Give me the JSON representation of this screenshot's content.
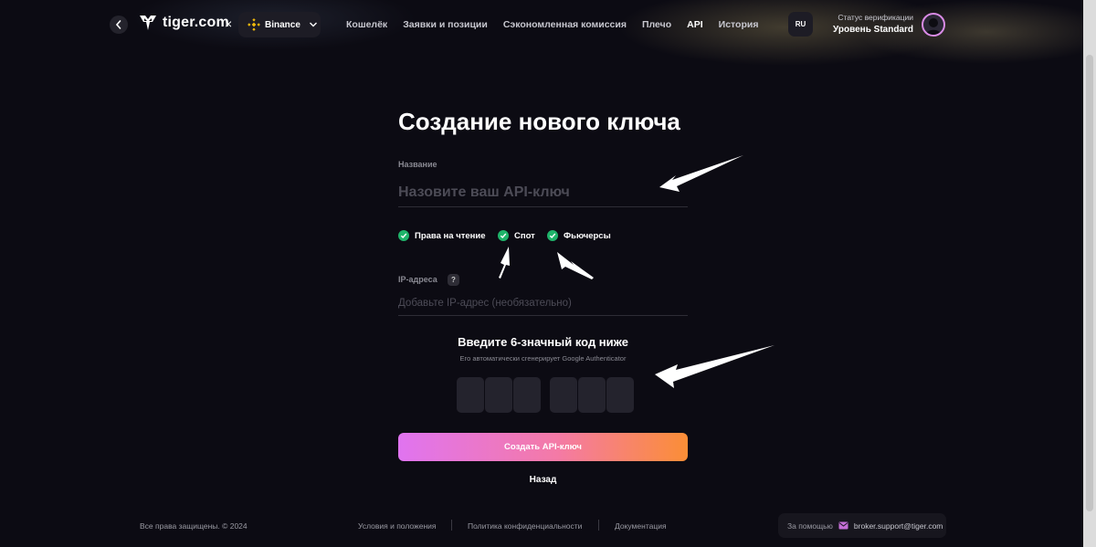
{
  "header": {
    "logo_text": "tiger.com",
    "separator": "×",
    "exchange": "Binance",
    "nav": [
      "Кошелёк",
      "Заявки и позиции",
      "Сэкономленная комиссия",
      "Плечо",
      "API",
      "История"
    ],
    "active_nav": "API",
    "language": "RU",
    "verification_label": "Статус верификации",
    "verification_level": "Уровень Standard"
  },
  "form": {
    "title": "Создание нового ключа",
    "name_label": "Название",
    "name_placeholder": "Назовите ваш API-ключ",
    "permissions": [
      "Права на чтение",
      "Спот",
      "Фьючерсы"
    ],
    "ip_label": "IP-адреса",
    "ip_help": "?",
    "ip_placeholder": "Добавьте IP-адрес (необязательно)",
    "code_title": "Введите 6-значный код ниже",
    "code_subtitle": "Его автоматически сгенерирует Google Authenticator",
    "code_digits": [
      "",
      "",
      "",
      "",
      "",
      ""
    ],
    "submit_label": "Создать API-ключ",
    "back_label": "Назад"
  },
  "footer": {
    "copyright": "Все права защищены. © 2024",
    "links": [
      "Условия и положения",
      "Политика конфиденциальности",
      "Документация"
    ],
    "support_label": "За помощью",
    "support_email": "broker.support@tiger.com"
  },
  "colors": {
    "background": "#0c0b13",
    "check_green": "#1fb36a",
    "button_gradient_start": "#e074f0",
    "button_gradient_end": "#fb8e36",
    "binance_yellow": "#f0b90b"
  }
}
